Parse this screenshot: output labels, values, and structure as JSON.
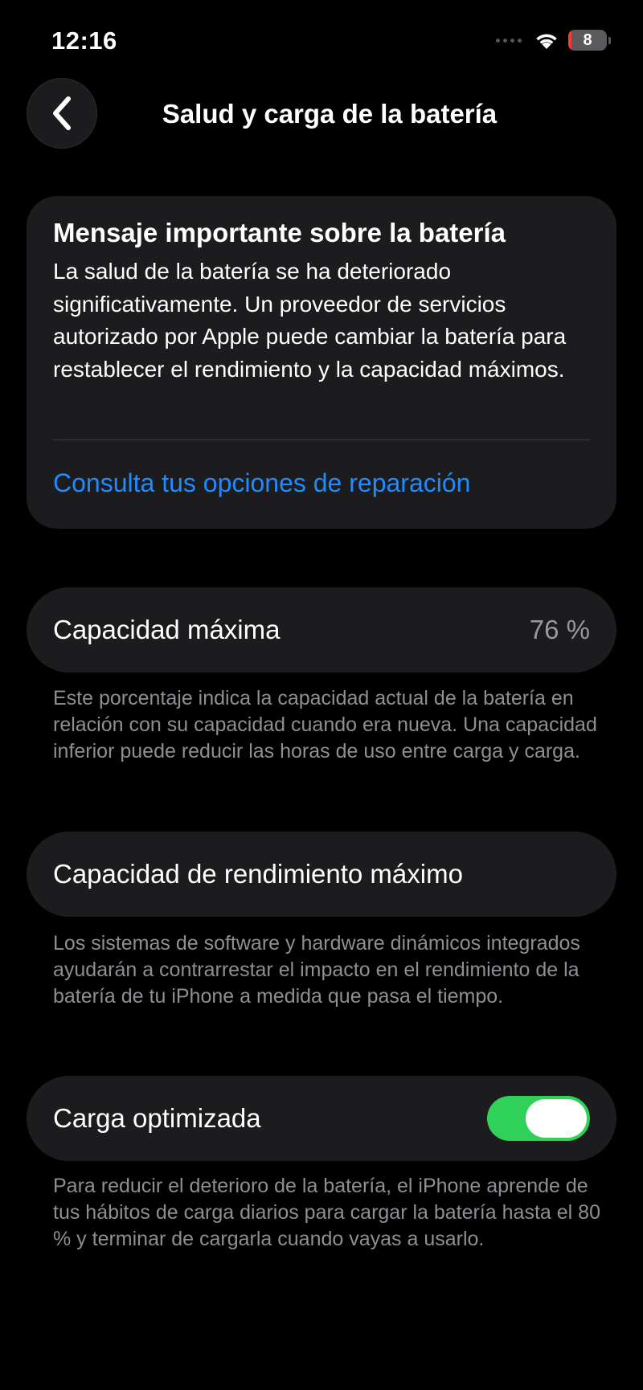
{
  "status_bar": {
    "time": "12:16",
    "battery_level": "8",
    "battery_fraction": 0.08,
    "battery_color": "#ff3b30",
    "signal_icon": "cellular-dots-icon",
    "wifi_icon": "wifi-icon"
  },
  "nav": {
    "back_icon": "chevron-left-icon",
    "title": "Salud y carga de la batería"
  },
  "alert": {
    "title": "Mensaje importante sobre la batería",
    "body": "La salud de la batería se ha deteriorado significativamente. Un proveedor de servicios autorizado por Apple puede cambiar la batería para restablecer el rendimiento y la capacidad máximos.",
    "link": "Consulta tus opciones de reparación",
    "link_color": "#1e8bff"
  },
  "capacity": {
    "label": "Capacidad máxima",
    "value": "76 %",
    "footnote": "Este porcentaje indica la capacidad actual de la batería en relación con su capacidad cuando era nueva. Una capacidad inferior puede reducir las horas de uso entre carga y carga."
  },
  "performance": {
    "label": "Capacidad de rendimiento máximo",
    "footnote": "Los sistemas de software y hardware dinámicos integrados ayudarán a contrarrestar el impacto en el rendimiento de la batería de tu iPhone a medida que pasa el tiempo."
  },
  "charging": {
    "label": "Carga optimizada",
    "enabled": true,
    "toggle_color": "#30d158",
    "footnote": "Para reducir el deterioro de la batería, el iPhone aprende de tus hábitos de carga diarios para cargar la batería hasta el 80 % y terminar de cargarla cuando vayas a usarlo."
  },
  "colors": {
    "background": "#000000",
    "card": "#1c1c1e",
    "secondary_text": "#8e8e93"
  }
}
